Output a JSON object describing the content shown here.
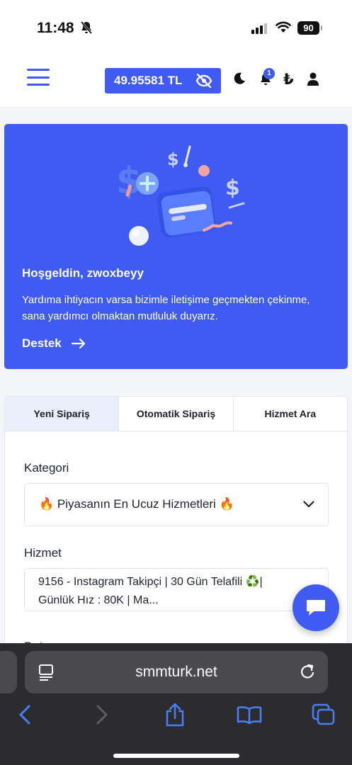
{
  "status_bar": {
    "time": "11:48",
    "battery": "90"
  },
  "header": {
    "balance": "49.95581 TL",
    "notification_count": "1",
    "currency_symbol": "₺"
  },
  "welcome": {
    "title": "Hoşgeldin, zwoxbeyy",
    "text": "Yardıma ihtiyacın varsa bizimle iletişime geçmekten çekinme, sana yardımcı olmaktan mutluluk duyarız.",
    "support_label": "Destek"
  },
  "order": {
    "tabs": [
      {
        "label": "Yeni Sipariş",
        "active": true
      },
      {
        "label": "Otomatik Sipariş",
        "active": false
      },
      {
        "label": "Hizmet Ara",
        "active": false
      }
    ],
    "category_label": "Kategori",
    "category_value": "🔥 Piyasanın En Ucuz Hizmetleri 🔥",
    "service_label": "Hizmet",
    "service_value": "9156 - Instagram Takipçi | 30 Gün Telafili ♻️| Günlük Hız : 80K | Ma...",
    "next_label": "Detay"
  },
  "browser": {
    "url": "smmturk.net"
  },
  "colors": {
    "accent": "#3f5bf1",
    "safari_bar": "#2c2c2e",
    "nav_blue": "#4a7cf6"
  }
}
